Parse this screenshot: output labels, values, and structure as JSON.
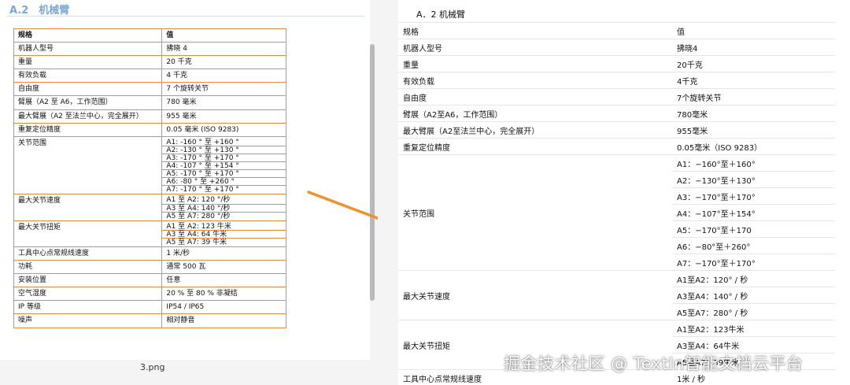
{
  "source": {
    "heading": "A.2　机械臂",
    "caption": "3.png",
    "header": {
      "key": "规格",
      "value": "值"
    },
    "rows": [
      {
        "key": "机器人型号",
        "values": [
          "拂晓 4"
        ]
      },
      {
        "key": "重量",
        "values": [
          "20 千克"
        ]
      },
      {
        "key": "有效负载",
        "values": [
          "4 千克"
        ]
      },
      {
        "key": "自由度",
        "values": [
          "7 个旋转关节"
        ]
      },
      {
        "key": "臂展（A2 至 A6，工作范围）",
        "values": [
          "780 毫米"
        ]
      },
      {
        "key": "最大臂展（A2 至法兰中心，完全展开）",
        "values": [
          "955 毫米"
        ]
      },
      {
        "key": "重复定位精度",
        "values": [
          "0.05 毫米 (ISO 9283)"
        ]
      },
      {
        "key": "关节范围",
        "values": [
          "A1: -160 ° 至 +160 °",
          "A2: -130 ° 至 +130 °",
          "A3: -170 ° 至 +170 °",
          "A4: -107 ° 至 +154 °",
          "A5: -170 ° 至 +170 °",
          "A6: -80 ° 至 +260 °",
          "A7: -170 ° 至 +170 °"
        ]
      },
      {
        "key": "最大关节速度",
        "values": [
          "A1 至 A2: 120 °/秒",
          "A3 至 A4: 140 °/秒",
          "A5 至 A7: 280 °/秒"
        ]
      },
      {
        "key": "最大关节扭矩",
        "values": [
          "A1 至 A2: 123 牛米",
          "A3 至 A4: 64 牛米",
          "A5 至 A7: 39 牛米"
        ]
      },
      {
        "key": "工具中心点常规线速度",
        "values": [
          "1 米/秒"
        ]
      },
      {
        "key": "功耗",
        "values": [
          "通常 500 瓦"
        ]
      },
      {
        "key": "安装位置",
        "values": [
          "任意"
        ]
      },
      {
        "key": "空气湿度",
        "values": [
          "20 % 至 80 % 非凝结"
        ]
      },
      {
        "key": "IP 等级",
        "values": [
          "IP54 / IP65"
        ]
      },
      {
        "key": "噪声",
        "values": [
          "相对静音"
        ]
      }
    ]
  },
  "result": {
    "heading": "A．2 机械臂",
    "header": {
      "key": "规格",
      "value": "值"
    },
    "rows": [
      {
        "key": "机器人型号",
        "values": [
          "拂晓4"
        ]
      },
      {
        "key": "重量",
        "values": [
          "20千克"
        ]
      },
      {
        "key": "有效负载",
        "values": [
          "4千克"
        ]
      },
      {
        "key": "自由度",
        "values": [
          "7个旋转关节"
        ]
      },
      {
        "key": "臂展（A2至A6，工作范围）",
        "values": [
          "780毫米"
        ]
      },
      {
        "key": "最大臂展（A2至法兰中心，完全展开）",
        "values": [
          "955毫米"
        ]
      },
      {
        "key": "重复定位精度",
        "values": [
          "0.05毫米（ISO 9283）"
        ]
      },
      {
        "key": "关节范围",
        "values": [
          "A1：−160°至＋160°",
          "A2：−130°至＋130°",
          "A3：−170°至＋170°",
          "A4：−107°至＋154°",
          "A5：−170°至＋170",
          "A6：−80°至＋260°",
          "A7：−170°至＋170°"
        ]
      },
      {
        "key": "最大关节速度",
        "values": [
          "A1至A2：120° / 秒",
          "A3至A4：140° / 秒",
          "A5至A7：280° / 秒"
        ]
      },
      {
        "key": "最大关节扭矩",
        "values": [
          "A1至A2：123牛米",
          "A3至A4：64牛米",
          "A5至A7：39牛米"
        ]
      },
      {
        "key": "工具中心点常规线速度",
        "values": [
          "1米 / 秒"
        ]
      }
    ]
  },
  "watermark": "掘金技术社区 @ TextIn智能文档云平台",
  "colors": {
    "table_border": "#ec8a3f",
    "arrow": "#f0922b",
    "heading_blue": "#7aa7d6"
  }
}
